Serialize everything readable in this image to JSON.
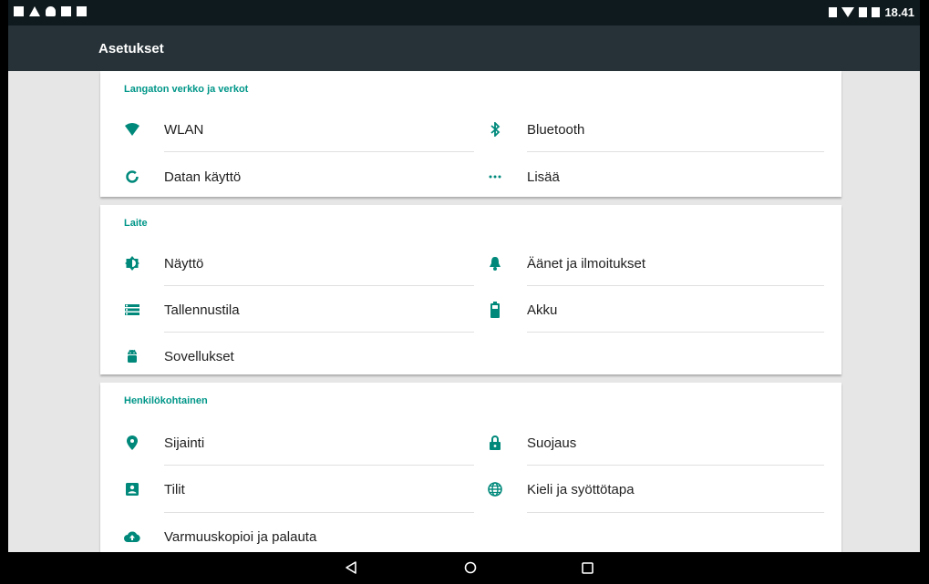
{
  "status_bar": {
    "time": "18.41"
  },
  "app_bar": {
    "title": "Asetukset"
  },
  "sections": [
    {
      "title": "Langaton verkko ja verkot",
      "items": [
        {
          "label": "WLAN",
          "icon": "wifi-icon"
        },
        {
          "label": "Bluetooth",
          "icon": "bluetooth-icon"
        },
        {
          "label": "Datan käyttö",
          "icon": "data-usage-icon"
        },
        {
          "label": "Lisää",
          "icon": "more-icon"
        }
      ]
    },
    {
      "title": "Laite",
      "items": [
        {
          "label": "Näyttö",
          "icon": "brightness-icon"
        },
        {
          "label": "Äänet ja ilmoitukset",
          "icon": "bell-icon"
        },
        {
          "label": "Tallennustila",
          "icon": "storage-icon"
        },
        {
          "label": "Akku",
          "icon": "battery-icon"
        },
        {
          "label": "Sovellukset",
          "icon": "android-icon"
        }
      ]
    },
    {
      "title": "Henkilökohtainen",
      "items": [
        {
          "label": "Sijainti",
          "icon": "location-icon"
        },
        {
          "label": "Suojaus",
          "icon": "lock-icon"
        },
        {
          "label": "Tilit",
          "icon": "account-icon"
        },
        {
          "label": "Kieli ja syöttötapa",
          "icon": "globe-icon"
        },
        {
          "label": "Varmuuskopioi ja palauta",
          "icon": "cloud-upload-icon"
        }
      ]
    }
  ],
  "colors": {
    "accent": "#009688",
    "appbar": "#263238",
    "statusbar": "#0f1a1e",
    "icon": "#00897b"
  }
}
